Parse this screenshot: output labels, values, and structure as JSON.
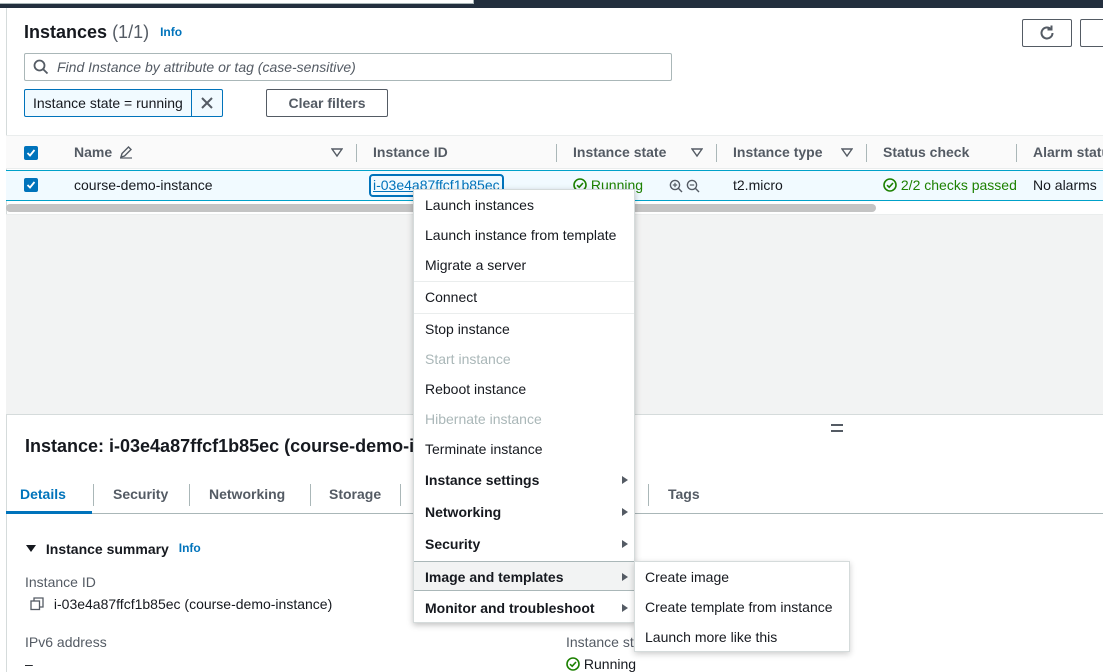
{
  "header": {
    "title": "Instances",
    "count": "(1/1)",
    "info": "Info"
  },
  "search": {
    "placeholder": "Find Instance by attribute or tag (case-sensitive)"
  },
  "filter": {
    "token": "Instance state = running",
    "clear_label": "Clear filters"
  },
  "table": {
    "columns": [
      "Name",
      "Instance ID",
      "Instance state",
      "Instance type",
      "Status check",
      "Alarm statu"
    ],
    "row": {
      "name": "course-demo-instance",
      "instance_id": "i-03e4a87ffcf1b85ec",
      "state": "Running",
      "type": "t2.micro",
      "status_check": "2/2 checks passed",
      "alarm": "No alarms"
    }
  },
  "detail": {
    "title": "Instance: i-03e4a87ffcf1b85ec (course-demo-i",
    "tabs": [
      "Details",
      "Security",
      "Networking",
      "Storage",
      "Tags"
    ],
    "summary_title": "Instance summary",
    "summary_info": "Info",
    "instance_id_label": "Instance ID",
    "instance_id_value": "i-03e4a87ffcf1b85ec (course-demo-instance)",
    "ipv6_label": "IPv6 address",
    "ipv6_value": "–",
    "state_label": "Instance st",
    "state_value": "Running"
  },
  "context_menu": {
    "items": [
      "Launch instances",
      "Launch instance from template",
      "Migrate a server",
      "Connect",
      "Stop instance",
      "Start instance",
      "Reboot instance",
      "Hibernate instance",
      "Terminate instance",
      "Instance settings",
      "Networking",
      "Security",
      "Image and templates",
      "Monitor and troubleshoot"
    ]
  },
  "submenu": {
    "items": [
      "Create image",
      "Create template from instance",
      "Launch more like this"
    ]
  },
  "colors": {
    "accent": "#0073bb",
    "success": "#1d8102",
    "header_dark": "#232f3e"
  }
}
